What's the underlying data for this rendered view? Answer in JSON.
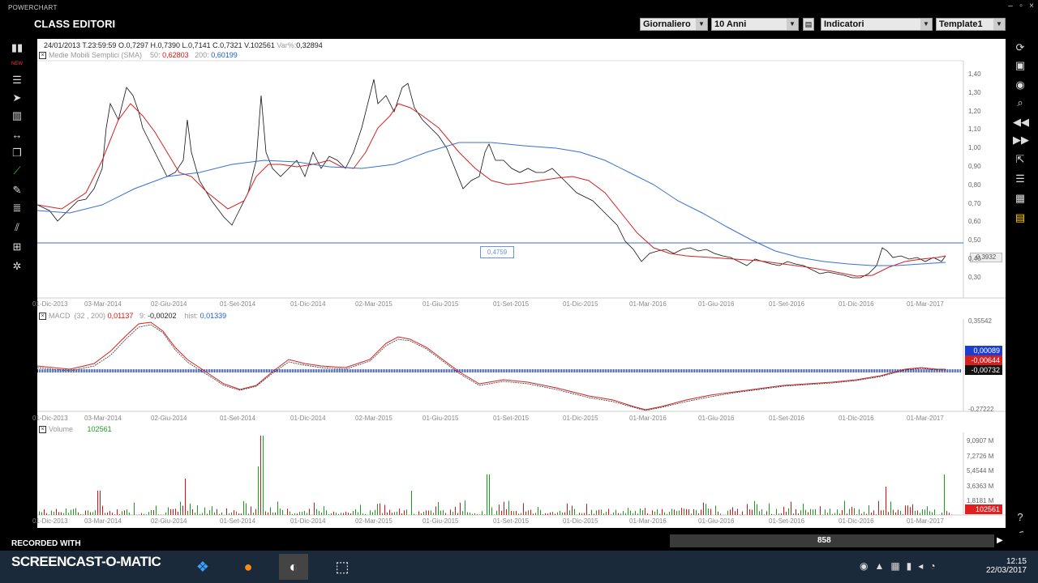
{
  "window": {
    "app_name": "POWERCHART",
    "title": "CLASS EDITORI"
  },
  "toolbar": {
    "period": "Giornaliero",
    "range": "10 Anni",
    "indicators": "Indicatori",
    "template": "Template1"
  },
  "price_panel": {
    "date": "24/01/2013",
    "time": "T.23:59:59",
    "open": "O.0,7297",
    "high": "H.0,7390",
    "low": "L.0,7141",
    "close": "C.0,7321",
    "volume": "V.102561",
    "var_label": "Var%:",
    "var_value": "0,32894",
    "sma_label": "Medie Mobili Semplici (SMA)",
    "sma50_label": "50:",
    "sma50_value": "0,62803",
    "sma200_label": "200:",
    "sma200_value": "0,60199",
    "y_ticks": [
      "1,40",
      "1,30",
      "1,20",
      "1,10",
      "1,00",
      "0,90",
      "0,80",
      "0,70",
      "0,60",
      "0,50",
      "0,40",
      "0,30"
    ],
    "hline_value": "0,4759",
    "last_value": "0,3932"
  },
  "macd_panel": {
    "label": "MACD",
    "params": "(32 , 200)",
    "macd_value": "0,01137",
    "signal_label": "9:",
    "signal_value": "-0,00202",
    "hist_label": "hist:",
    "hist_value": "0,01339",
    "y_top": "0,35542",
    "y_bottom": "-0,27222",
    "badge1": "0,00089",
    "badge2": "-0,00644",
    "badge3": "-0,00732"
  },
  "volume_panel": {
    "label": "Volume",
    "value": "102561",
    "y_ticks": [
      "9,0907 M",
      "7,2726 M",
      "5,4544 M",
      "3,6363 M",
      "1,8181 M"
    ],
    "badge": "102561"
  },
  "x_axis": [
    "01-Dic-2013",
    "03-Mar-2014",
    "02-Giu-2014",
    "01-Set-2014",
    "01-Dic-2014",
    "02-Mar-2015",
    "01-Giu-2015",
    "01-Set-2015",
    "01-Dic-2015",
    "01-Mar-2016",
    "01-Giu-2016",
    "01-Set-2016",
    "01-Dic-2016",
    "01-Mar-2017"
  ],
  "status": {
    "bar_count": "858",
    "recorded_with": "RECORDED WITH",
    "brand": "SCREENCAST-O-MATIC"
  },
  "clock": {
    "time": "12:15",
    "date": "22/03/2017"
  },
  "icons": [
    "layout-icon",
    "new-icon",
    "cursor-icon",
    "line-icon",
    "fibonacci-icon",
    "settings-icon"
  ],
  "colors": {
    "sma50": "#d42020",
    "sma200": "#3a6fd0",
    "price": "#000000",
    "volume_up": "#1a9c1a",
    "volume_down": "#d11"
  }
}
